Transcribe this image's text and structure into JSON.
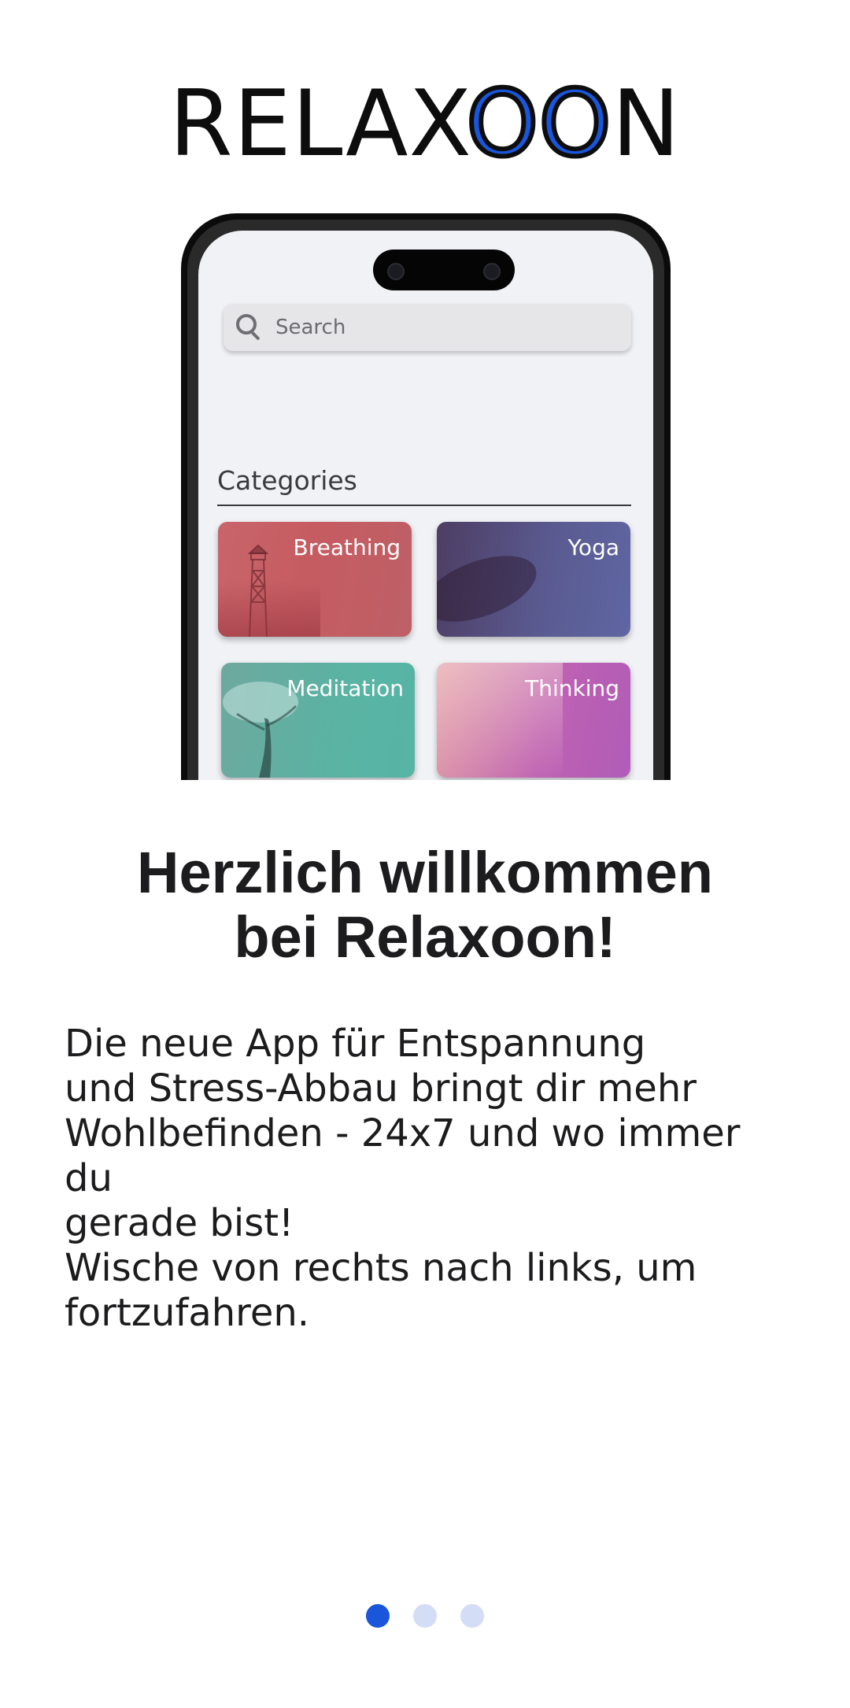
{
  "logo": {
    "part1": "RELAX",
    "o1": "O",
    "o2": "O",
    "part2": "N"
  },
  "mockup": {
    "search_placeholder": "Search",
    "categories_title": "Categories",
    "categories": [
      {
        "label": "Breathing"
      },
      {
        "label": "Yoga"
      },
      {
        "label": "Meditation"
      },
      {
        "label": "Thinking"
      }
    ]
  },
  "headline": {
    "line1": "Herzlich willkommen",
    "line2": "bei Relaxoon!"
  },
  "paragraphs": {
    "intro_l1": "Die neue App für Entspannung",
    "intro_l2": "und Stress-Abbau bringt dir mehr",
    "intro_l3": "Wohlbefinden - 24x7 und wo immer du",
    "intro_l4": "gerade bist!",
    "swipe_l1": "Wische von rechts nach links, um",
    "swipe_l2": "fortzufahren."
  },
  "pagination": {
    "total": 3,
    "active_index": 0
  },
  "colors": {
    "accent": "#1a56db",
    "inactive_dot": "#d3ddf6"
  }
}
